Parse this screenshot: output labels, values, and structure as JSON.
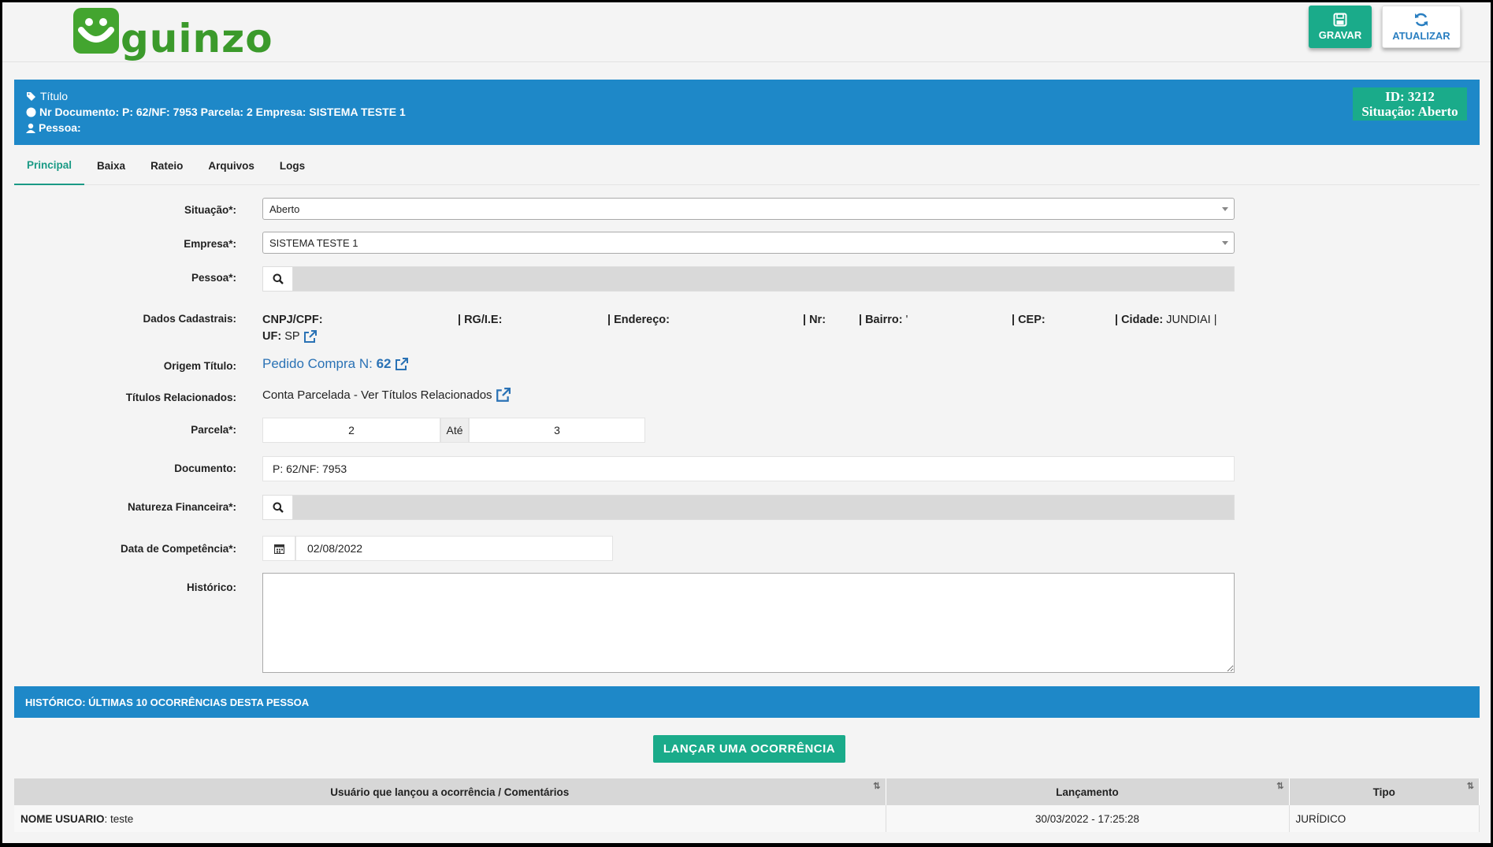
{
  "brand": {
    "logo_text": "guinzo",
    "accent": "#43a52f"
  },
  "toolbar": {
    "save_label": "GRAVAR",
    "refresh_label": "ATUALIZAR"
  },
  "header": {
    "title": "Título",
    "doc_line": "Nr Documento: P: 62/NF: 7953 Parcela: 2 Empresa: SISTEMA TESTE 1",
    "person_line": "Pessoa:",
    "id": "ID: 3212",
    "situacao": "Situação: Aberto",
    "colors": {
      "bar": "#1e88c8",
      "badge": "#1aab8a"
    }
  },
  "tabs": [
    {
      "label": "Principal"
    },
    {
      "label": "Baixa"
    },
    {
      "label": "Rateio"
    },
    {
      "label": "Arquivos"
    },
    {
      "label": "Logs"
    }
  ],
  "form": {
    "situacao": {
      "label": "Situação*:",
      "value": "Aberto"
    },
    "empresa": {
      "label": "Empresa*:",
      "value": "SISTEMA TESTE 1"
    },
    "pessoa": {
      "label": "Pessoa*:",
      "value": ""
    },
    "dados": {
      "label": "Dados Cadastrais:",
      "cnpj_label": "CNPJ/CPF:",
      "rg_label": "| RG/I.E:",
      "endereco_label": "| Endereço:",
      "nr_label": "| Nr:",
      "bairro_label": "| Bairro:",
      "bairro_value": "'",
      "cep_label": "| CEP:",
      "cidade_label": "| Cidade:",
      "cidade_value": "JUNDIAI |",
      "uf_label": "UF:",
      "uf_value": "SP"
    },
    "origem": {
      "label": "Origem Título:",
      "link_text": "Pedido Compra N:",
      "number": "62"
    },
    "relacionados": {
      "label": "Títulos Relacionados:",
      "text": "Conta Parcelada - Ver Títulos Relacionados"
    },
    "parcela": {
      "label": "Parcela*:",
      "from": "2",
      "sep": "Até",
      "to": "3"
    },
    "documento": {
      "label": "Documento:",
      "value": "P: 62/NF: 7953"
    },
    "natureza": {
      "label": "Natureza Financeira*:",
      "value": ""
    },
    "competencia": {
      "label": "Data de Competência*:",
      "value": "02/08/2022"
    },
    "historico": {
      "label": "Histórico:",
      "value": ""
    }
  },
  "history": {
    "title": "HISTÓRICO: ÚLTIMAS 10 OCORRÊNCIAS DESTA PESSOA",
    "launch_label": "LANÇAR UMA OCORRÊNCIA",
    "columns": [
      "Usuário que lançou a ocorrência / Comentários",
      "Lançamento",
      "Tipo"
    ],
    "rows": [
      {
        "user": "NOME USUARIO",
        "comment": ": teste",
        "date": "30/03/2022 - 17:25:28",
        "tipo": "JURÍDICO"
      }
    ]
  }
}
